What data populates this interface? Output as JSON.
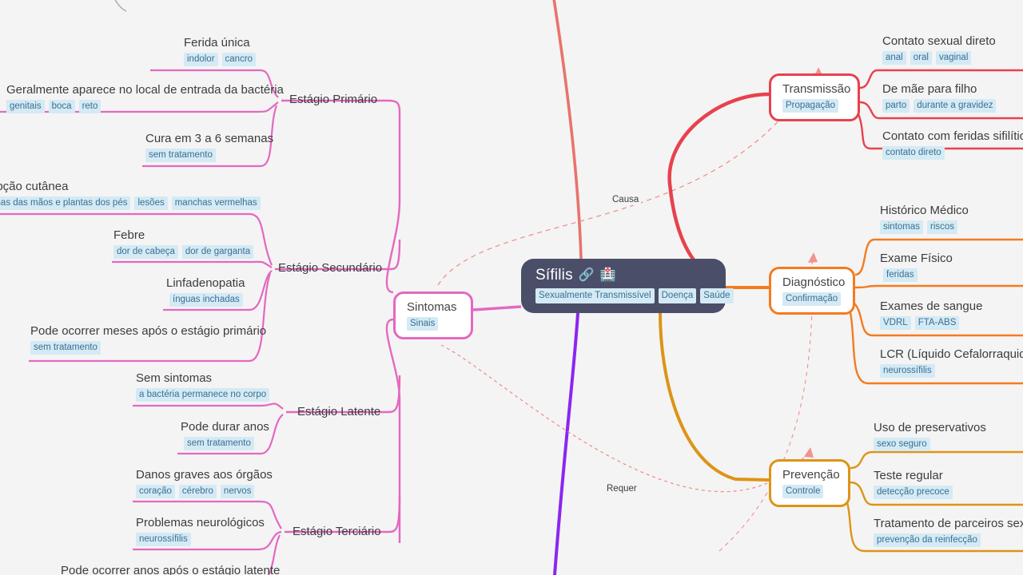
{
  "central": {
    "title": "Sífilis",
    "icons": [
      "link-icon",
      "hospital-icon"
    ],
    "icon_glyphs": [
      "🔗",
      "🏥"
    ],
    "tags": [
      "Sexualmente Transmissível",
      "Doença",
      "Saúde"
    ],
    "color": "#4b4e69"
  },
  "relations": [
    {
      "label": "Causa",
      "color": "#f08a84"
    },
    {
      "label": "Requer",
      "color": "#f08a84"
    }
  ],
  "branches": {
    "sintomas": {
      "label": "Sintomas",
      "tag": "Sinais",
      "color": "#e468c0",
      "stages": [
        {
          "label": "Estágio Primário",
          "leaves": [
            {
              "text": "Ferida única",
              "tags": [
                "indolor",
                "cancro"
              ]
            },
            {
              "text": "Geralmente aparece no local de entrada da bactéria",
              "tags": [
                "genitais",
                "boca",
                "reto"
              ]
            },
            {
              "text": "Cura em 3 a 6 semanas",
              "tags": [
                "sem tratamento"
              ]
            }
          ]
        },
        {
          "label": "Estágio Secundário",
          "leaves": [
            {
              "text": "Erupção cutânea",
              "tags": [
                "palmas das mãos e plantas dos pés",
                "lesões",
                "manchas vermelhas"
              ]
            },
            {
              "text": "Febre",
              "tags": [
                "dor de cabeça",
                "dor de garganta"
              ]
            },
            {
              "text": "Linfadenopatia",
              "tags": [
                "ínguas inchadas"
              ]
            },
            {
              "text": "Pode ocorrer meses após o estágio primário",
              "tags": [
                "sem tratamento"
              ]
            }
          ]
        },
        {
          "label": "Estágio Latente",
          "leaves": [
            {
              "text": "Sem sintomas",
              "tags": [
                "a bactéria permanece no corpo"
              ]
            },
            {
              "text": "Pode durar anos",
              "tags": [
                "sem tratamento"
              ]
            }
          ]
        },
        {
          "label": "Estágio Terciário",
          "leaves": [
            {
              "text": "Danos graves aos órgãos",
              "tags": [
                "coração",
                "cérebro",
                "nervos"
              ]
            },
            {
              "text": "Problemas neurológicos",
              "tags": [
                "neurossífilis"
              ]
            },
            {
              "text": "Pode ocorrer anos após o estágio latente",
              "tags": []
            }
          ]
        }
      ]
    },
    "transmissao": {
      "label": "Transmissão",
      "tag": "Propagação",
      "color": "#e8414e",
      "leaves": [
        {
          "text": "Contato sexual direto",
          "tags": [
            "anal",
            "oral",
            "vaginal"
          ]
        },
        {
          "text": "De mãe para filho",
          "tags": [
            "parto",
            "durante a gravidez"
          ]
        },
        {
          "text": "Contato com feridas sifilíticas",
          "tags": [
            "contato direto"
          ]
        }
      ]
    },
    "diagnostico": {
      "label": "Diagnóstico",
      "tag": "Confirmação",
      "color": "#f47b20",
      "leaves": [
        {
          "text": "Histórico Médico",
          "tags": [
            "sintomas",
            "riscos"
          ]
        },
        {
          "text": "Exame Físico",
          "tags": [
            "feridas"
          ]
        },
        {
          "text": "Exames de sangue",
          "tags": [
            "VDRL",
            "FTA-ABS"
          ]
        },
        {
          "text": "LCR (Líquido Cefalorraquidiano)",
          "tags": [
            "neurossífilis"
          ]
        }
      ]
    },
    "prevencao": {
      "label": "Prevenção",
      "tag": "Controle",
      "color": "#dd9416",
      "leaves": [
        {
          "text": "Uso de preservativos",
          "tags": [
            "sexo seguro"
          ]
        },
        {
          "text": "Teste regular",
          "tags": [
            "detecção precoce"
          ]
        },
        {
          "text": "Tratamento de parceiros sexuais",
          "tags": [
            "prevenção da reinfecção"
          ]
        }
      ]
    }
  },
  "palette": {
    "background": "#f4f4f4",
    "tag_bg": "#d4eaf4",
    "tag_text": "#3a6f93",
    "text": "#3c3c3c",
    "purple_link": "#8b26f0",
    "salmon_link": "#e8736d"
  }
}
